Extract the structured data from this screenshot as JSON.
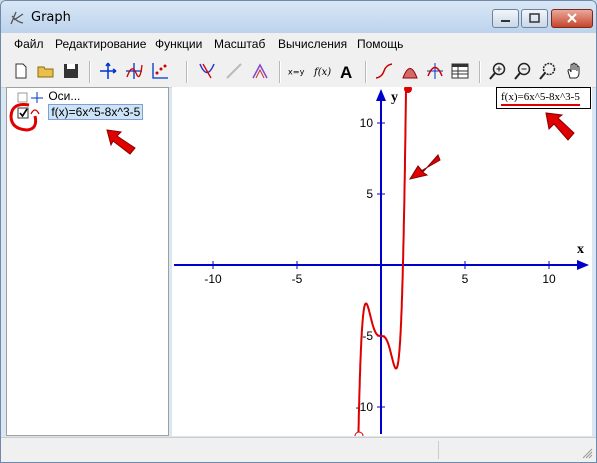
{
  "window": {
    "title": "Graph"
  },
  "menu": [
    "Файл",
    "Редактирование",
    "Функции",
    "Масштаб",
    "Вычисления",
    "Помощь"
  ],
  "toolbar_icons": [
    "new-file-icon",
    "open-folder-icon",
    "save-icon",
    "axes-move-icon",
    "insert-function-icon",
    "insert-points-icon",
    "tangent-icon",
    "shading-icon",
    "series-icon",
    "xy-label-icon",
    "fx-icon",
    "text-icon",
    "inserted-curve-icon",
    "relation-icon",
    "evaluate-icon",
    "table-icon",
    "zoom-in-icon",
    "zoom-out-icon",
    "zoom-window-icon",
    "pan-hand-icon"
  ],
  "tree": {
    "axes_label": "Оси...",
    "function_label": "f(x)=6x^5-8x^3-5",
    "function_checked": true
  },
  "graph": {
    "legend": "f(x)=6x^5-8x^3-5",
    "x_axis_label": "x",
    "y_axis_label": "y",
    "x_ticks": [
      "-10",
      "-5",
      "5",
      "10"
    ],
    "y_ticks": [
      "10",
      "5",
      "-5",
      "-10"
    ],
    "curve_color": "#dd0000",
    "axis_color": "#0000cc"
  },
  "colors": {
    "annotation_red": "#e00000"
  }
}
